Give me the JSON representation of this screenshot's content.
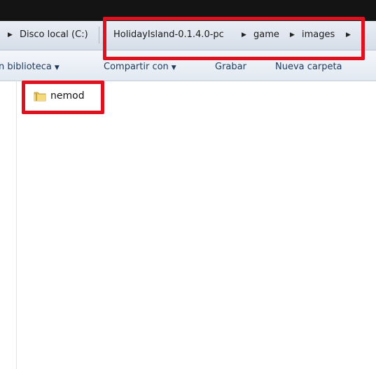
{
  "address_bar": {
    "segments": [
      "Disco local (C:)",
      "HolidayIsland-0.1.4.0-pc",
      "game",
      "images"
    ]
  },
  "toolbar": {
    "library": "n biblioteca",
    "share": "Compartir con",
    "burn": "Grabar",
    "new_folder": "Nueva carpeta"
  },
  "files": [
    {
      "name": "nemod",
      "type": "folder"
    }
  ],
  "highlights": {
    "color": "#e0111e"
  }
}
